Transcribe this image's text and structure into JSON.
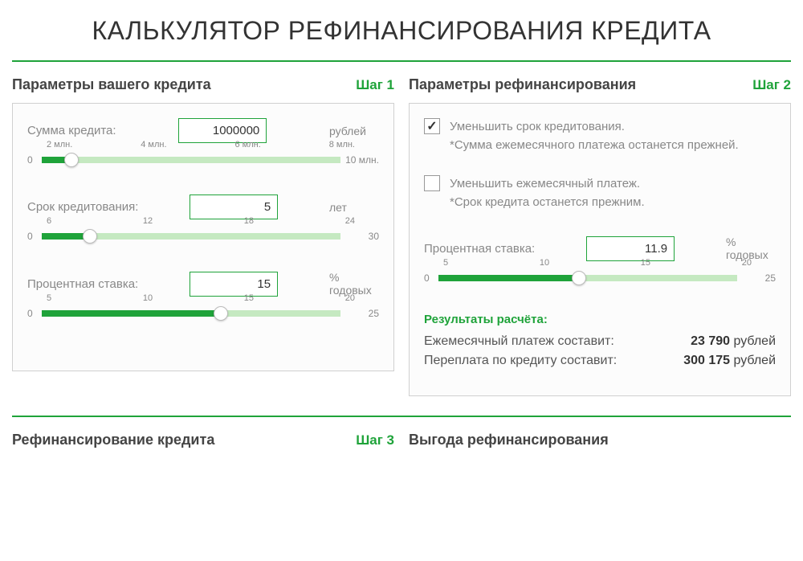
{
  "title": "КАЛЬКУЛЯТОР РЕФИНАНСИРОВАНИЯ КРЕДИТА",
  "left": {
    "title": "Параметры вашего кредита",
    "step": "Шаг 1",
    "amount": {
      "label": "Сумма кредита:",
      "value": "1000000",
      "unit": "рублей",
      "min": "0",
      "max": "10 млн.",
      "ticks": [
        "2 млн.",
        "4 млн.",
        "6 млн.",
        "8 млн."
      ],
      "fill_pct": "10%"
    },
    "term": {
      "label": "Срок кредитования:",
      "value": "5",
      "unit": "лет",
      "min": "0",
      "max": "30",
      "ticks": [
        "6",
        "12",
        "18",
        "24"
      ],
      "fill_pct": "16%"
    },
    "rate": {
      "label": "Процентная ставка:",
      "value": "15",
      "unit": "% годовых",
      "min": "0",
      "max": "25",
      "ticks": [
        "5",
        "10",
        "15",
        "20"
      ],
      "fill_pct": "60%"
    }
  },
  "right": {
    "title": "Параметры рефинансирования",
    "step": "Шаг 2",
    "opt1": {
      "label": "Уменьшить срок кредитования.",
      "note": "*Сумма ежемесячного платежа останется прежней."
    },
    "opt2": {
      "label": "Уменьшить ежемесячный платеж.",
      "note": "*Срок кредита останется прежним."
    },
    "rate": {
      "label": "Процентная ставка:",
      "value": "11.9",
      "unit": "% годовых",
      "min": "0",
      "max": "25",
      "ticks": [
        "5",
        "10",
        "15",
        "20"
      ],
      "fill_pct": "47%"
    },
    "results": {
      "title": "Результаты расчёта:",
      "monthly_label": "Ежемесячный платеж составит:",
      "monthly_value": "23 790",
      "monthly_unit": "рублей",
      "overpay_label": "Переплата по кредиту составит:",
      "overpay_value": "300 175",
      "overpay_unit": "рублей"
    }
  },
  "bottom_left": {
    "title": "Рефинансирование кредита",
    "step": "Шаг 3"
  },
  "bottom_right": {
    "title": "Выгода рефинансирования"
  }
}
